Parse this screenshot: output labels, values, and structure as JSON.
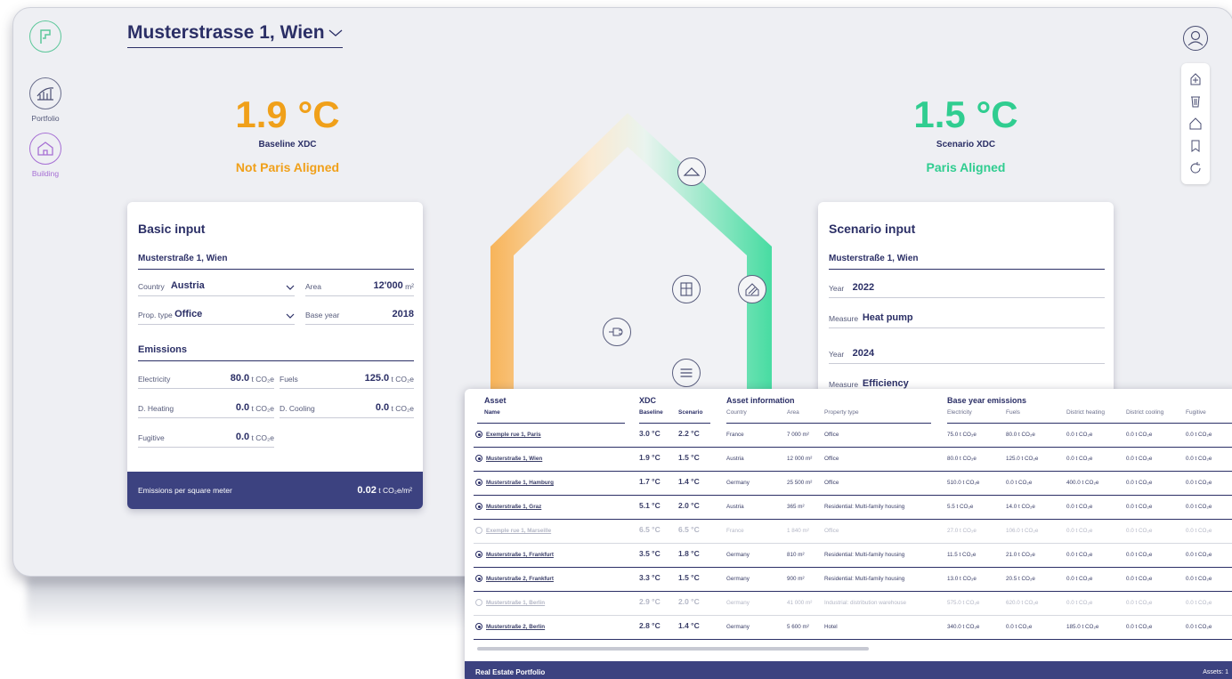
{
  "nav": {
    "logo_icon": "logo-icon",
    "items": [
      {
        "label": "Portfolio",
        "icon": "portfolio-chart-icon"
      },
      {
        "label": "Building",
        "icon": "building-house-icon"
      }
    ]
  },
  "header": {
    "address": "Musterstrasse 1, Wien"
  },
  "baseline": {
    "value": "1.9 °C",
    "caption": "Baseline XDC",
    "status": "Not Paris Aligned",
    "color": "#f0a01a"
  },
  "scenario": {
    "value": "1.5 °C",
    "caption": "Scenario XDC",
    "status": "Paris Aligned",
    "color": "#30cd90"
  },
  "toolbar": {
    "icons": [
      "add-icon",
      "trash-icon",
      "house-outline-icon",
      "bookmark-icon",
      "refresh-icon"
    ]
  },
  "basic_input": {
    "title": "Basic input",
    "address": "Musterstraße 1, Wien",
    "country_label": "Country",
    "country_value": "Austria",
    "area_label": "Area",
    "area_value": "12'000",
    "area_unit": "m²",
    "prop_type_label": "Prop. type",
    "prop_type_value": "Office",
    "base_year_label": "Base year",
    "base_year_value": "2018",
    "emissions_title": "Emissions",
    "electricity_label": "Electricity",
    "electricity_value": "80.0",
    "fuels_label": "Fuels",
    "fuels_value": "125.0",
    "dheating_label": "D. Heating",
    "dheating_value": "0.0",
    "dcooling_label": "D. Cooling",
    "dcooling_value": "0.0",
    "fugitive_label": "Fugitive",
    "fugitive_value": "0.0",
    "unit": "t CO₂e",
    "footer_label": "Emissions per square meter",
    "footer_value": "0.02",
    "footer_unit": "t CO₂e/m²"
  },
  "scenario_input": {
    "title": "Scenario input",
    "address": "Musterstraße 1, Wien",
    "year_label": "Year",
    "measure_label": "Measure",
    "year1": "2022",
    "measure1": "Heat pump",
    "year2": "2024",
    "measure2": "Efficiency"
  },
  "table": {
    "groups": {
      "asset": "Asset",
      "xdc": "XDC",
      "info": "Asset information",
      "emissions": "Base year emissions"
    },
    "columns": {
      "name": "Name",
      "baseline": "Baseline",
      "scenario": "Scenario",
      "country": "Country",
      "area": "Area",
      "property_type": "Property type",
      "electricity": "Electricity",
      "fuels": "Fuels",
      "district_heating": "District heating",
      "district_cooling": "District cooling",
      "fugitive": "Fugitive"
    },
    "rows": [
      {
        "name": "Exemple rue 1, Paris",
        "baseline": "3.0 °C",
        "scenario": "2.2 °C",
        "country": "France",
        "area": "7 000 m²",
        "type": "Office",
        "elec": "75.0 t CO₂e",
        "fuels": "80.0 t CO₂e",
        "dh": "0.0 t CO₂e",
        "dc": "0.0 t CO₂e",
        "fug": "0.0 t CO₂e",
        "selected": true,
        "disabled": false
      },
      {
        "name": "Musterstraße 1, Wien",
        "baseline": "1.9 °C",
        "scenario": "1.5 °C",
        "country": "Austria",
        "area": "12 000 m²",
        "type": "Office",
        "elec": "80.0 t CO₂e",
        "fuels": "125.0 t CO₂e",
        "dh": "0.0 t CO₂e",
        "dc": "0.0 t CO₂e",
        "fug": "0.0 t CO₂e",
        "selected": true,
        "disabled": false
      },
      {
        "name": "Musterstraße 1, Hamburg",
        "baseline": "1.7 °C",
        "scenario": "1.4 °C",
        "country": "Germany",
        "area": "25 500 m²",
        "type": "Office",
        "elec": "510.0 t CO₂e",
        "fuels": "0.0 t CO₂e",
        "dh": "400.0 t CO₂e",
        "dc": "0.0 t CO₂e",
        "fug": "0.0 t CO₂e",
        "selected": true,
        "disabled": false
      },
      {
        "name": "Musterstraße 1, Graz",
        "baseline": "5.1 °C",
        "scenario": "2.0 °C",
        "country": "Austria",
        "area": "365 m²",
        "type": "Residential: Multi-family housing",
        "elec": "5.5 t CO₂e",
        "fuels": "14.0 t CO₂e",
        "dh": "0.0 t CO₂e",
        "dc": "0.0 t CO₂e",
        "fug": "0.0 t CO₂e",
        "selected": true,
        "disabled": false
      },
      {
        "name": "Exemple rue 1, Marseille",
        "baseline": "6.5 °C",
        "scenario": "6.5 °C",
        "country": "France",
        "area": "1 840 m²",
        "type": "Office",
        "elec": "27.0 t CO₂e",
        "fuels": "106.0 t CO₂e",
        "dh": "0.0 t CO₂e",
        "dc": "0.0 t CO₂e",
        "fug": "0.0 t CO₂e",
        "selected": false,
        "disabled": true
      },
      {
        "name": "Musterstraße 1, Frankfurt",
        "baseline": "3.5 °C",
        "scenario": "1.8 °C",
        "country": "Germany",
        "area": "810 m²",
        "type": "Residential: Multi-family housing",
        "elec": "11.5 t CO₂e",
        "fuels": "21.0 t CO₂e",
        "dh": "0.0 t CO₂e",
        "dc": "0.0 t CO₂e",
        "fug": "0.0 t CO₂e",
        "selected": true,
        "disabled": false
      },
      {
        "name": "Musterstraße 2, Frankfurt",
        "baseline": "3.3 °C",
        "scenario": "1.5 °C",
        "country": "Germany",
        "area": "900 m²",
        "type": "Residential: Multi-family housing",
        "elec": "13.0 t CO₂e",
        "fuels": "20.5 t CO₂e",
        "dh": "0.0 t CO₂e",
        "dc": "0.0 t CO₂e",
        "fug": "0.0 t CO₂e",
        "selected": true,
        "disabled": false
      },
      {
        "name": "Musterstraße 1, Berlin",
        "baseline": "2.9 °C",
        "scenario": "2.0 °C",
        "country": "Germany",
        "area": "41 000 m²",
        "type": "Industrial: distribution warehouse",
        "elec": "575.0 t CO₂e",
        "fuels": "620.0 t CO₂e",
        "dh": "0.0 t CO₂e",
        "dc": "0.0 t CO₂e",
        "fug": "0.0 t CO₂e",
        "selected": false,
        "disabled": true
      },
      {
        "name": "Musterstraße 2, Berlin",
        "baseline": "2.8 °C",
        "scenario": "1.4 °C",
        "country": "Germany",
        "area": "5 600 m²",
        "type": "Hotel",
        "elec": "340.0 t CO₂e",
        "fuels": "0.0 t CO₂e",
        "dh": "185.0 t CO₂e",
        "dc": "0.0 t CO₂e",
        "fug": "0.0 t CO₂e",
        "selected": true,
        "disabled": false
      }
    ],
    "footer_title": "Real Estate Portfolio",
    "footer_right": "Assets: 1"
  },
  "house_icons": [
    "roof-icon",
    "window-icon",
    "wall-insulation-icon",
    "plug-icon",
    "heating-radiator-icon"
  ]
}
